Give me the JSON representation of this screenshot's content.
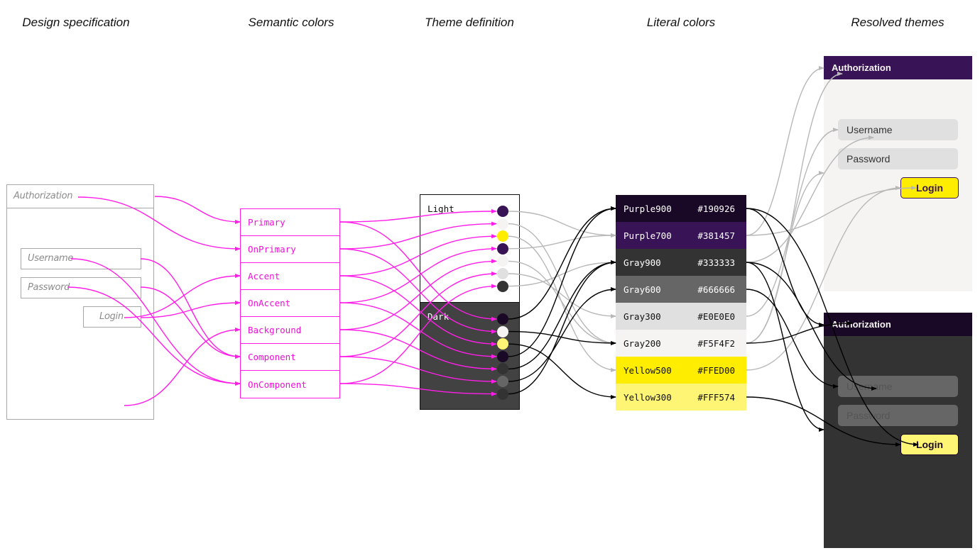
{
  "column_titles": {
    "design_spec": "Design specification",
    "semantic": "Semantic colors",
    "theme_def": "Theme definition",
    "literal": "Literal colors",
    "resolved": "Resolved themes"
  },
  "design_spec": {
    "title": "Authorization",
    "username": "Username",
    "password": "Password",
    "login": "Login"
  },
  "semantic_colors": [
    "Primary",
    "OnPrimary",
    "Accent",
    "OnAccent",
    "Background",
    "Component",
    "OnComponent"
  ],
  "theme_definition": {
    "light": {
      "label": "Light",
      "swatches": [
        {
          "role": "Primary",
          "literal": "Purple700"
        },
        {
          "role": "OnPrimary",
          "literal": "Gray200"
        },
        {
          "role": "Accent",
          "literal": "Yellow500"
        },
        {
          "role": "OnAccent",
          "literal": "Purple700"
        },
        {
          "role": "Background",
          "literal": "Gray200"
        },
        {
          "role": "Component",
          "literal": "Gray300"
        },
        {
          "role": "OnComponent",
          "literal": "Gray900"
        }
      ]
    },
    "dark": {
      "label": "Dark",
      "swatches": [
        {
          "role": "Primary",
          "literal": "Purple900"
        },
        {
          "role": "OnPrimary",
          "literal": "Gray200"
        },
        {
          "role": "Accent",
          "literal": "Yellow300"
        },
        {
          "role": "OnAccent",
          "literal": "Purple900"
        },
        {
          "role": "Background",
          "literal": "Gray900"
        },
        {
          "role": "Component",
          "literal": "Gray600"
        },
        {
          "role": "OnComponent",
          "literal": "Gray900"
        }
      ]
    }
  },
  "literal_colors": [
    {
      "name": "Purple900",
      "hex": "#190926",
      "text": "#ffffff"
    },
    {
      "name": "Purple700",
      "hex": "#381457",
      "text": "#ffffff"
    },
    {
      "name": "Gray900",
      "hex": "#333333",
      "text": "#ffffff"
    },
    {
      "name": "Gray600",
      "hex": "#666666",
      "text": "#ffffff"
    },
    {
      "name": "Gray300",
      "hex": "#E0E0E0",
      "text": "#111111"
    },
    {
      "name": "Gray200",
      "hex": "#F5F4F2",
      "text": "#111111"
    },
    {
      "name": "Yellow500",
      "hex": "#FFED00",
      "text": "#111111"
    },
    {
      "name": "Yellow300",
      "hex": "#FFF574",
      "text": "#111111"
    }
  ],
  "resolved_themes": {
    "light": {
      "title": "Authorization",
      "username": "Username",
      "password": "Password",
      "login": "Login",
      "colors": {
        "header": "#381457",
        "header_text": "#F5F4F2",
        "background": "#F5F4F2",
        "field": "#E0E0E0",
        "field_text": "#333333",
        "button": "#FFED00",
        "button_text": "#381457",
        "button_border": "#381457"
      }
    },
    "dark": {
      "title": "Authorization",
      "username": "Username",
      "password": "Password",
      "login": "Login",
      "colors": {
        "header": "#190926",
        "header_text": "#F5F4F2",
        "background": "#333333",
        "field": "#666666",
        "field_text": "#555555",
        "button": "#FFF574",
        "button_text": "#190926",
        "button_border": "#190926"
      }
    }
  },
  "link_colors": {
    "spec_to_semantic": "#ff1ee8",
    "light_links": "#b8b8b8",
    "dark_links": "#000000"
  },
  "links": {
    "spec_to_semantic": [
      {
        "from": "title-right",
        "to": "Primary"
      },
      {
        "from": "title-text",
        "to": "OnPrimary"
      },
      {
        "from": "login-text",
        "to": "Accent"
      },
      {
        "from": "login-right",
        "to": "OnAccent"
      },
      {
        "from": "body-bottom",
        "to": "Background"
      },
      {
        "from": "username-right",
        "to": "Component"
      },
      {
        "from": "password-right",
        "to": "Component"
      },
      {
        "from": "username-text",
        "to": "OnComponent"
      },
      {
        "from": "password-text",
        "to": "OnComponent"
      }
    ],
    "literal_to_resolved_light": [
      {
        "from": "Purple700",
        "to": "header"
      },
      {
        "from": "Gray200",
        "to": "header-text"
      },
      {
        "from": "Gray200",
        "to": "background"
      },
      {
        "from": "Gray300",
        "to": "field"
      },
      {
        "from": "Gray900",
        "to": "field-text"
      },
      {
        "from": "Yellow500",
        "to": "button"
      },
      {
        "from": "Purple700",
        "to": "button-text"
      }
    ],
    "literal_to_resolved_dark": [
      {
        "from": "Purple900",
        "to": "header"
      },
      {
        "from": "Gray200",
        "to": "header-text"
      },
      {
        "from": "Gray900",
        "to": "background"
      },
      {
        "from": "Gray600",
        "to": "field"
      },
      {
        "from": "Gray900",
        "to": "field-text"
      },
      {
        "from": "Yellow300",
        "to": "button"
      },
      {
        "from": "Purple900",
        "to": "button-text"
      }
    ]
  }
}
